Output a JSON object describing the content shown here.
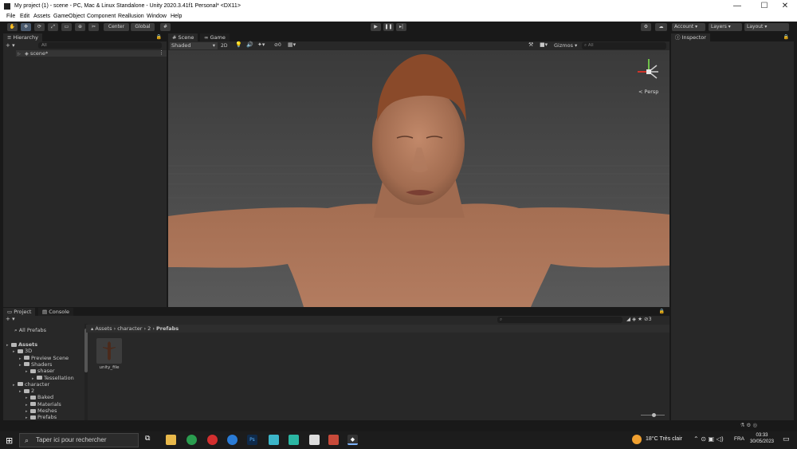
{
  "window": {
    "title": "My project (1) - scene - PC, Mac & Linux Standalone - Unity 2020.3.41f1 Personal* <DX11>",
    "minimize": "—",
    "maximize": "☐",
    "close": "✕"
  },
  "menu": [
    "File",
    "Edit",
    "Assets",
    "GameObject",
    "Component",
    "Reallusion",
    "Window",
    "Help"
  ],
  "toolbar": {
    "pivot": "Center",
    "space": "Global",
    "account": "Account",
    "layers": "Layers",
    "layout": "Layout"
  },
  "hierarchy": {
    "tab": "Hierarchy",
    "search_placeholder": "All",
    "add": "+ ▾",
    "scene_item": "scene*"
  },
  "scene_view": {
    "tab_scene": "Scene",
    "tab_game": "Game",
    "shading": "Shaded",
    "mode_2d": "2D",
    "hidden_count": "0",
    "gizmos": "Gizmos",
    "search_placeholder": "All",
    "persp": "< Persp"
  },
  "inspector": {
    "tab": "Inspector"
  },
  "project": {
    "tab_project": "Project",
    "tab_console": "Console",
    "favorites_item": "All Prefabs",
    "breadcrumb": [
      "Assets",
      "character",
      "2",
      "Prefabs"
    ],
    "hidden_packages": "3",
    "tree": [
      {
        "label": "Assets",
        "depth": 0,
        "bold": true
      },
      {
        "label": "3D",
        "depth": 1
      },
      {
        "label": "Preview Scene",
        "depth": 2
      },
      {
        "label": "Shaders",
        "depth": 2
      },
      {
        "label": "shaser",
        "depth": 3
      },
      {
        "label": "Tessellation",
        "depth": 4
      },
      {
        "label": "character",
        "depth": 1
      },
      {
        "label": "2",
        "depth": 2
      },
      {
        "label": "Baked",
        "depth": 3
      },
      {
        "label": "Materials",
        "depth": 3
      },
      {
        "label": "Meshes",
        "depth": 3
      },
      {
        "label": "Prefabs",
        "depth": 3
      }
    ],
    "assets": [
      {
        "label": "unity_file"
      }
    ]
  },
  "taskbar": {
    "search_placeholder": "Taper ici pour rechercher",
    "weather": "18°C  Très clair",
    "lang": "FRA",
    "time": "03:33",
    "date": "30/05/2023"
  },
  "colors": {
    "accent": "#4a5a6e",
    "panel": "#282828",
    "editor_bg": "#191919",
    "skin": "#b27a5c"
  }
}
